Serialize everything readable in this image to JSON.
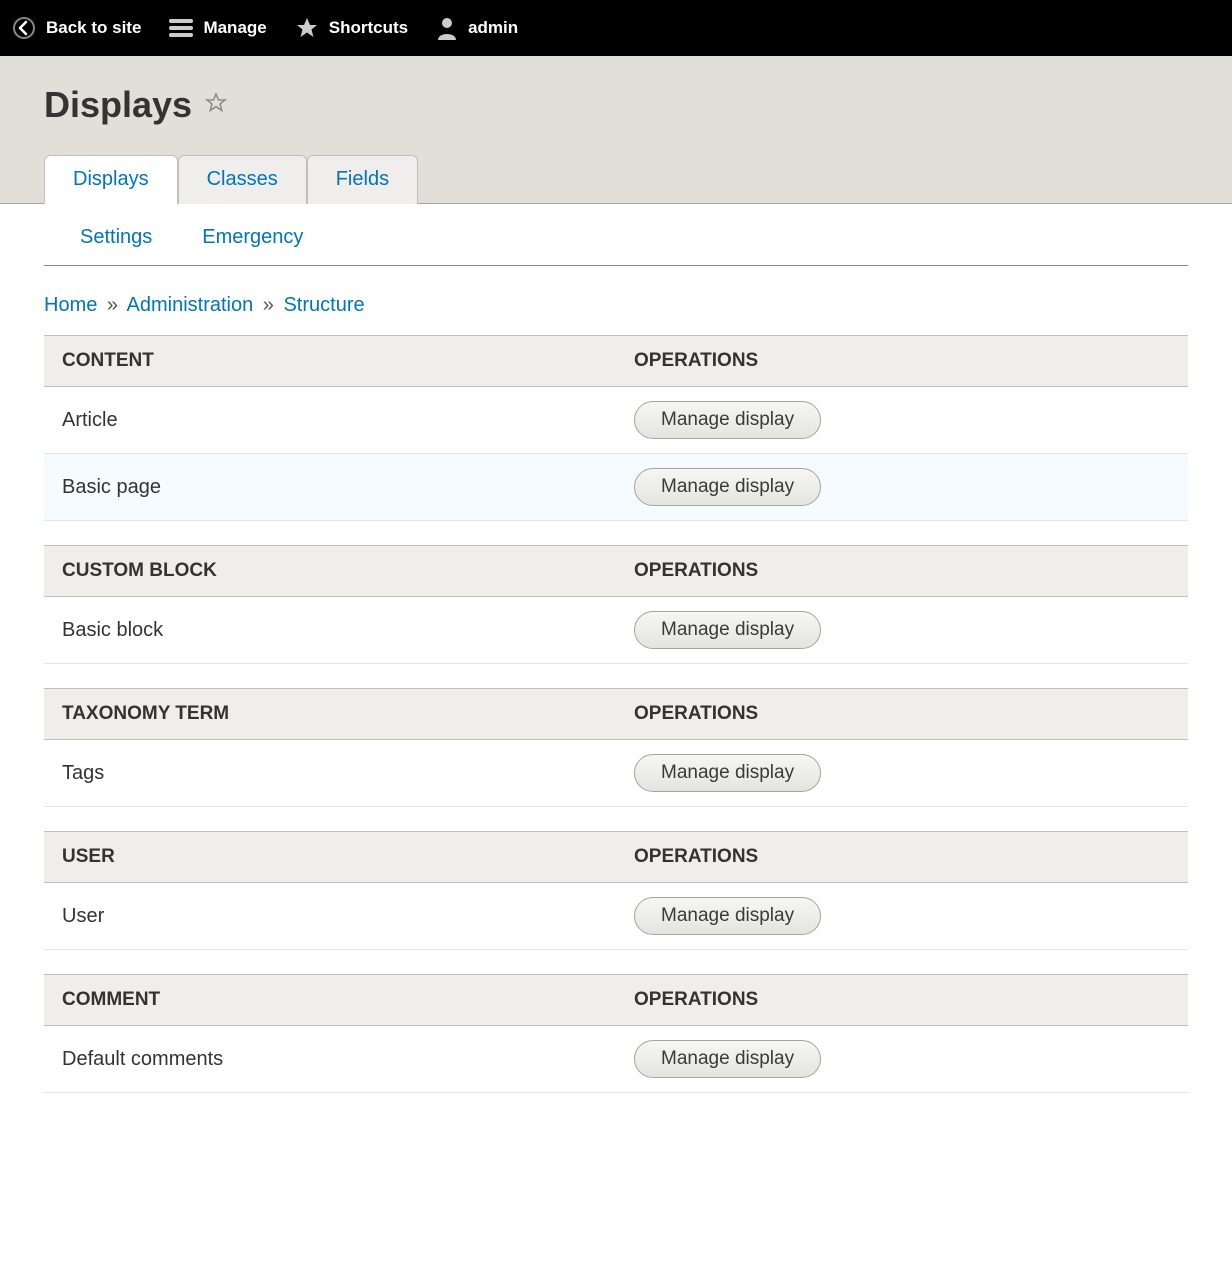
{
  "toolbar": {
    "back": "Back to site",
    "manage": "Manage",
    "shortcuts": "Shortcuts",
    "user": "admin"
  },
  "page": {
    "title": "Displays"
  },
  "primary_tabs": [
    {
      "label": "Displays",
      "active": true
    },
    {
      "label": "Classes",
      "active": false
    },
    {
      "label": "Fields",
      "active": false
    }
  ],
  "secondary_tabs": [
    {
      "label": "Settings"
    },
    {
      "label": "Emergency"
    }
  ],
  "breadcrumb": {
    "items": [
      "Home",
      "Administration",
      "Structure"
    ],
    "sep": "»"
  },
  "operations_header": "Operations",
  "manage_label": "Manage display",
  "sections": [
    {
      "header": "Content",
      "rows": [
        {
          "label": "Article"
        },
        {
          "label": "Basic page"
        }
      ]
    },
    {
      "header": "Custom block",
      "rows": [
        {
          "label": "Basic block"
        }
      ]
    },
    {
      "header": "Taxonomy term",
      "rows": [
        {
          "label": "Tags"
        }
      ]
    },
    {
      "header": "User",
      "rows": [
        {
          "label": "User"
        }
      ]
    },
    {
      "header": "Comment",
      "rows": [
        {
          "label": "Default comments"
        }
      ]
    }
  ]
}
